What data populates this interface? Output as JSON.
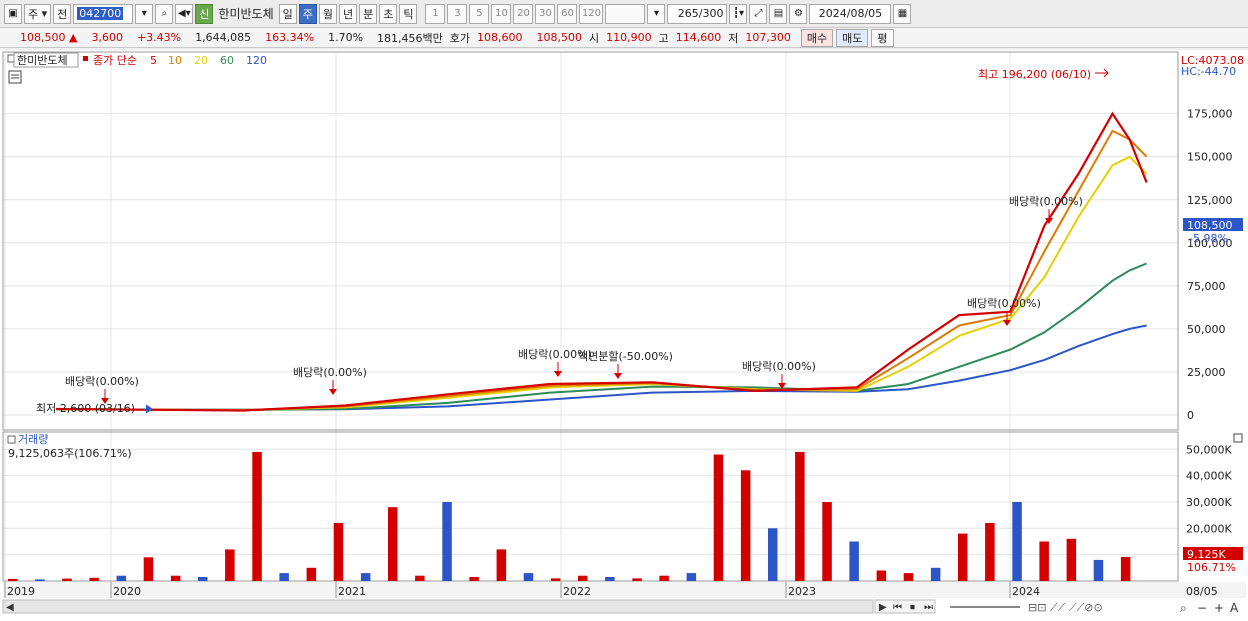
{
  "toolbar": {
    "market": "주",
    "mode": "전",
    "code": "042700",
    "new_badge": "신",
    "stock_name": "한미반도체",
    "periods": [
      "일",
      "주",
      "월",
      "년",
      "분",
      "초",
      "틱"
    ],
    "active_period": "주",
    "intervals": [
      "1",
      "3",
      "5",
      "10",
      "20",
      "30",
      "60",
      "120"
    ],
    "count": "265",
    "count_total": "/300",
    "date": "2024/08/05"
  },
  "quote": {
    "price": "108,500",
    "arrow": "▲",
    "change": "3,600",
    "change_pct": "+3.43%",
    "volume": "1,644,085",
    "volume_ratio": "163.34%",
    "turnover": "1.70%",
    "amount": "181,456백만",
    "bid_label": "호가",
    "ask": "108,600",
    "bid": "108,500",
    "open_label": "시",
    "open": "110,900",
    "high_label": "고",
    "high": "114,600",
    "low_label": "저",
    "low": "107,300",
    "buy_button": "매수",
    "sell_button": "매도",
    "eval_button": "평"
  },
  "chart": {
    "title_stock": "한미반도체",
    "ma_label": "종가 단순",
    "ma_periods": [
      "5",
      "10",
      "20",
      "60",
      "120"
    ],
    "ma_colors": [
      "#d40000",
      "#e07b00",
      "#e6d000",
      "#2e8b57",
      "#2c56c8"
    ],
    "lc_text": "LC:4073.08",
    "hc_text": "HC:-44.70",
    "current_price_tag": "108,500",
    "current_change_tag": "-5.98%",
    "max_note": "최고 196,200 (06/10)",
    "min_note": "최저 2,600 (03/16)",
    "annotations": [
      "배당락(0.00%)",
      "배당락(0.00%)",
      "배당락(0.00%)",
      "액면분할(-50.00%)",
      "배당락(0.00%)",
      "배당락(0.00%)",
      "배당락(0.00%)"
    ],
    "y_ticks": [
      "175,000",
      "150,000",
      "125,000",
      "100,000",
      "75,000",
      "50,000",
      "25,000",
      "0"
    ],
    "volume_title": "거래량",
    "volume_value": "9,125,063주(106.71%)",
    "volume_ticks": [
      "50,000K",
      "40,000K",
      "30,000K",
      "20,000K",
      "10,000K"
    ],
    "volume_tag": "9,125K",
    "volume_pct_tag": "106.71%",
    "x_labels": [
      "2019",
      "2020",
      "2021",
      "2022",
      "2023",
      "2024"
    ],
    "x_end_label": "08/05"
  },
  "chart_data": {
    "type": "line",
    "title": "",
    "xlabel": "",
    "ylabel": "",
    "ylim": [
      0,
      196200
    ],
    "x": [
      "2019-04",
      "2019-10",
      "2020-03",
      "2020-09",
      "2021-03",
      "2021-09",
      "2022-03",
      "2022-09",
      "2023-03",
      "2023-06",
      "2023-09",
      "2023-12",
      "2024-02",
      "2024-04",
      "2024-06",
      "2024-07",
      "2024-08"
    ],
    "series": [
      {
        "name": "5",
        "values": [
          3500,
          3000,
          2600,
          5500,
          12000,
          18000,
          19000,
          14000,
          16000,
          38000,
          58000,
          60000,
          110000,
          140000,
          175000,
          160000,
          135000
        ]
      },
      {
        "name": "10",
        "values": [
          3500,
          3100,
          2800,
          5000,
          11000,
          17000,
          18500,
          14500,
          15000,
          33000,
          52000,
          58000,
          95000,
          130000,
          165000,
          160000,
          150000
        ]
      },
      {
        "name": "20",
        "values": [
          3400,
          3100,
          2900,
          4500,
          10000,
          16000,
          18000,
          15000,
          14000,
          28000,
          46000,
          56000,
          80000,
          115000,
          145000,
          150000,
          140000
        ]
      },
      {
        "name": "60",
        "values": [
          3300,
          3200,
          3000,
          3500,
          7000,
          13000,
          16500,
          16000,
          14000,
          18000,
          28000,
          38000,
          48000,
          62000,
          78000,
          84000,
          88000
        ]
      },
      {
        "name": "120",
        "values": [
          3300,
          3200,
          3100,
          3300,
          5000,
          9000,
          13000,
          14000,
          13500,
          15000,
          20000,
          26000,
          32000,
          40000,
          47000,
          50000,
          52000
        ]
      }
    ],
    "volume": [
      0.8,
      0.6,
      0.9,
      1.2,
      2.0,
      9.0,
      2.0,
      1.5,
      12.0,
      49.0,
      3.0,
      5.0,
      22.0,
      3.0,
      28.0,
      2.0,
      30.0,
      1.5,
      12.0,
      3.0,
      1.0,
      2.0,
      1.5,
      1.0,
      2.0,
      3.0,
      48.0,
      42.0,
      20.0,
      49.0,
      30.0,
      15.0,
      4.0,
      3.0,
      5.0,
      18.0,
      22.0,
      30.0,
      15.0,
      16.0,
      8.0,
      9.1
    ]
  }
}
